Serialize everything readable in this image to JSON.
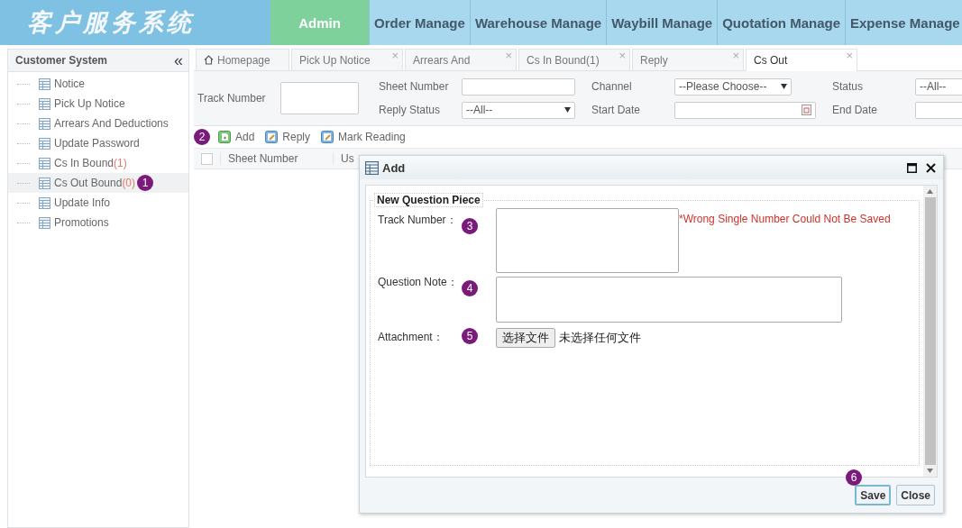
{
  "header": {
    "logo": "客户服务系统",
    "nav": [
      {
        "label": "Admin",
        "selected": true
      },
      {
        "label": "Order Manage",
        "selected": false
      },
      {
        "label": "Warehouse Manage",
        "selected": false
      },
      {
        "label": "Waybill Manage",
        "selected": false
      },
      {
        "label": "Quotation Manage",
        "selected": false
      },
      {
        "label": "Expense Manage",
        "selected": false
      }
    ]
  },
  "sidebar": {
    "title": "Customer System",
    "collapse": "«",
    "items": [
      {
        "label": "Notice",
        "selected": false
      },
      {
        "label": "Pick Up Notice",
        "selected": false
      },
      {
        "label": "Arrears And Deductions",
        "selected": false
      },
      {
        "label": "Update Password",
        "selected": false
      },
      {
        "label": "Cs In Bound",
        "count": "(1)",
        "selected": false
      },
      {
        "label": "Cs Out Bound",
        "count": "(0)",
        "selected": true,
        "badge": "1"
      },
      {
        "label": "Update Info",
        "selected": false
      },
      {
        "label": "Promotions",
        "selected": false
      }
    ]
  },
  "tabs": [
    {
      "label": "Homepage",
      "kind": "home",
      "selected": false
    },
    {
      "label": "Pick Up Notice",
      "kind": "closable",
      "selected": false
    },
    {
      "label": "Arrears And",
      "kind": "closable",
      "selected": false
    },
    {
      "label": "Cs In Bound(1)",
      "kind": "closable",
      "selected": false
    },
    {
      "label": "Reply",
      "kind": "closable",
      "selected": false
    },
    {
      "label": "Cs Out",
      "kind": "closable",
      "selected": true
    }
  ],
  "close_mark": "×",
  "filters": {
    "track_number": {
      "label": "Track Number"
    },
    "sheet_number": {
      "label": "Sheet Number"
    },
    "reply_status": {
      "label": "Reply Status",
      "value": "--All--"
    },
    "channel": {
      "label": "Channel",
      "value": "--Please Choose--"
    },
    "start_date": {
      "label": "Start Date"
    },
    "status": {
      "label": "Status",
      "value": "--All--"
    },
    "end_date": {
      "label": "End Date"
    }
  },
  "toolbar": {
    "badge": "2",
    "buttons": [
      {
        "label": "Add",
        "kind": "add"
      },
      {
        "label": "Reply",
        "kind": "edit"
      },
      {
        "label": "Mark Reading",
        "kind": "edit"
      }
    ]
  },
  "table": {
    "select_all_checked": false,
    "columns": [
      "Sheet Number",
      "Us"
    ]
  },
  "dialog": {
    "title": "Add",
    "legend": "New Question Piece",
    "fields": [
      {
        "label": "Track Number：",
        "badge": "3",
        "kind": "textarea",
        "error": "*Wrong Single Number Could Not Be Saved"
      },
      {
        "label": "Question Note：",
        "badge": "4",
        "kind": "wide"
      },
      {
        "label": "Attachment：",
        "badge": "5",
        "kind": "file",
        "button": "选择文件",
        "status": "未选择任何文件"
      }
    ],
    "footer_badge": "6",
    "buttons": [
      {
        "label": "Save",
        "selected": true
      },
      {
        "label": "Close",
        "selected": false
      }
    ]
  }
}
